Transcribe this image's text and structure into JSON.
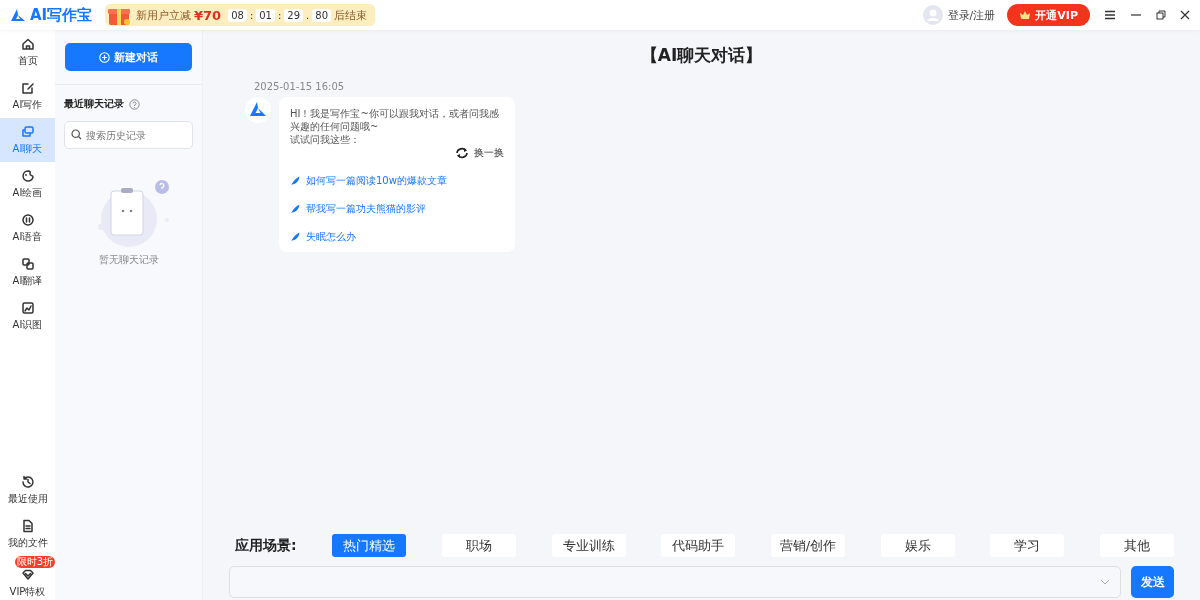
{
  "header": {
    "logo": "AI写作宝",
    "promo": {
      "text": "新用户立减",
      "amount": "¥70",
      "timer": [
        {
          "value": "08",
          "sep": ":"
        },
        {
          "value": "01",
          "sep": ":"
        },
        {
          "value": "29",
          "sep": "."
        },
        {
          "value": "80"
        }
      ],
      "suffix": "后结束"
    },
    "login": "登录/注册",
    "vip_button": "开通VIP"
  },
  "nav": {
    "items": [
      {
        "label": "首页",
        "selected": false
      },
      {
        "label": "AI写作",
        "selected": false
      },
      {
        "label": "AI聊天",
        "selected": true
      },
      {
        "label": "AI绘画",
        "selected": false
      },
      {
        "label": "AI语音",
        "selected": false
      },
      {
        "label": "AI翻译",
        "selected": false
      },
      {
        "label": "AI识图",
        "selected": false
      }
    ],
    "bottom_items": [
      {
        "label": "最近使用",
        "selected": false
      },
      {
        "label": "我的文件",
        "selected": false
      },
      {
        "label": "VIP特权",
        "selected": false,
        "badge": "限时3折"
      }
    ]
  },
  "history": {
    "new_button": "新建对话",
    "title": "最近聊天记录",
    "search": {
      "placeholder": "搜索历史记录"
    },
    "empty_text": "暂无聊天记录"
  },
  "chat": {
    "title": "【AI聊天对话】",
    "timestamp": "2025-01-15 16:05",
    "greeting": "HI！我是写作宝~你可以跟我对话，或者问我感兴趣的任何问题哦~",
    "prompt": "试试问我这些：",
    "refresh": "换一换",
    "suggestions": [
      "如何写一篇阅读10w的爆款文章",
      "帮我写一篇功夫熊猫的影评",
      "失眠怎么办"
    ]
  },
  "scenarios": {
    "label": "应用场景:",
    "tabs": [
      {
        "label": "热门精选",
        "selected": true
      },
      {
        "label": "职场",
        "selected": false
      },
      {
        "label": "专业训练",
        "selected": false
      },
      {
        "label": "代码助手",
        "selected": false
      },
      {
        "label": "营销/创作",
        "selected": false
      },
      {
        "label": "娱乐",
        "selected": false
      },
      {
        "label": "学习",
        "selected": false
      },
      {
        "label": "其他",
        "selected": false
      }
    ]
  },
  "composer": {
    "send_button": "发送"
  }
}
